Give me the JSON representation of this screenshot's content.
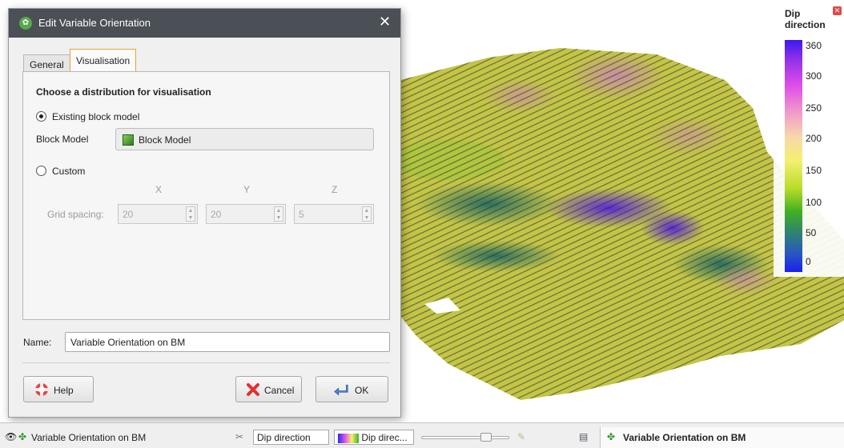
{
  "dialog": {
    "title": "Edit Variable Orientation",
    "tabs": [
      {
        "label": "General"
      },
      {
        "label": "Visualisation"
      }
    ],
    "section_title": "Choose a distribution for visualisation",
    "option_existing": "Existing block model",
    "block_model_label": "Block Model",
    "block_model_value": "Block Model",
    "option_custom": "Custom",
    "axis_x": "X",
    "axis_y": "Y",
    "axis_z": "Z",
    "grid_spacing_label": "Grid spacing:",
    "grid_x": "20",
    "grid_y": "20",
    "grid_z": "5",
    "name_label": "Name:",
    "name_value": "Variable Orientation on BM",
    "help_label": "Help",
    "cancel_label": "Cancel",
    "ok_label": "OK"
  },
  "legend": {
    "title": "Dip direction",
    "ticks": [
      "360",
      "300",
      "250",
      "200",
      "150",
      "100",
      "50",
      "0"
    ],
    "close_glyph": "✕"
  },
  "statusbar": {
    "object_name": "Variable Orientation on BM",
    "colour_by": "Dip direction",
    "colourmap": "Dip direc...",
    "right_object_name": "Variable Orientation on BM"
  },
  "colors": {
    "titlebar": "#4b4f56",
    "active_tab_border": "#f0a030",
    "legend_top": "#3a18f0",
    "legend_bottom": "#1a20f0"
  },
  "icons": [
    "app-leaf-icon",
    "close-icon",
    "cube-icon",
    "help-lifebuoy-icon",
    "cancel-x-icon",
    "ok-arrow-icon",
    "eye-icon",
    "tool-icon",
    "dropdown-chevron-icon"
  ]
}
